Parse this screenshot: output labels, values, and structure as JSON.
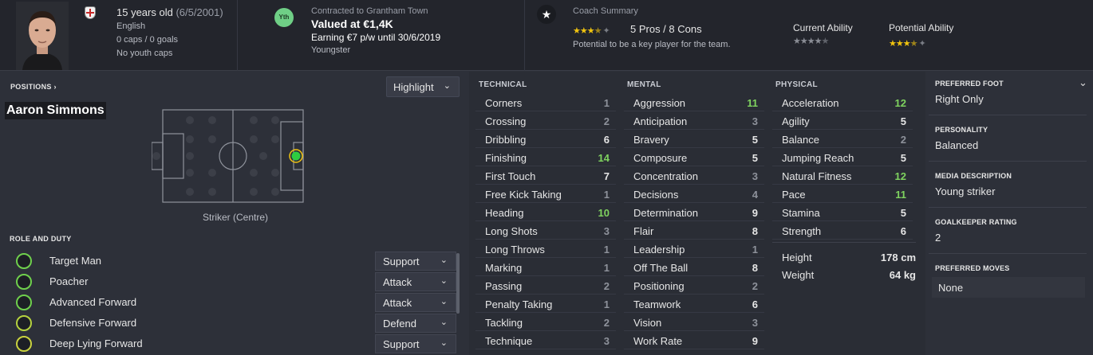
{
  "player": {
    "name": "Aaron Simmons",
    "age_line": "15 years old",
    "dob": "(6/5/2001)",
    "nationality": "English",
    "caps": "0 caps / 0 goals",
    "youth_caps": "No youth caps"
  },
  "contract": {
    "badge": "Yth",
    "club_line": "Contracted to Grantham Town",
    "value": "Valued at €1,4K",
    "earning": "Earning €7 p/w until 30/6/2019",
    "type": "Youngster"
  },
  "coach": {
    "title": "Coach Summary",
    "pros_cons": "5 Pros / 8 Cons",
    "text": "Potential to be a key player for the team.",
    "current_label": "Current Ability",
    "potential_label": "Potential Ability",
    "coach_stars": 3.5,
    "current_stars": 0,
    "potential_stars": 3.5
  },
  "positions": {
    "header": "POSITIONS ›",
    "highlight": "Highlight",
    "position_name": "Striker (Centre)"
  },
  "roles": {
    "header": "ROLE AND DUTY",
    "items": [
      {
        "name": "Target Man",
        "duty": "Support"
      },
      {
        "name": "Poacher",
        "duty": "Attack"
      },
      {
        "name": "Advanced Forward",
        "duty": "Attack"
      },
      {
        "name": "Defensive Forward",
        "duty": "Defend"
      },
      {
        "name": "Deep Lying Forward",
        "duty": "Support"
      }
    ]
  },
  "technical": {
    "header": "TECHNICAL",
    "attrs": [
      {
        "name": "Corners",
        "value": "1"
      },
      {
        "name": "Crossing",
        "value": "2"
      },
      {
        "name": "Dribbling",
        "value": "6"
      },
      {
        "name": "Finishing",
        "value": "14"
      },
      {
        "name": "First Touch",
        "value": "7"
      },
      {
        "name": "Free Kick Taking",
        "value": "1"
      },
      {
        "name": "Heading",
        "value": "10"
      },
      {
        "name": "Long Shots",
        "value": "3"
      },
      {
        "name": "Long Throws",
        "value": "1"
      },
      {
        "name": "Marking",
        "value": "1"
      },
      {
        "name": "Passing",
        "value": "2"
      },
      {
        "name": "Penalty Taking",
        "value": "1"
      },
      {
        "name": "Tackling",
        "value": "2"
      },
      {
        "name": "Technique",
        "value": "3"
      }
    ]
  },
  "mental": {
    "header": "MENTAL",
    "attrs": [
      {
        "name": "Aggression",
        "value": "11"
      },
      {
        "name": "Anticipation",
        "value": "3"
      },
      {
        "name": "Bravery",
        "value": "5"
      },
      {
        "name": "Composure",
        "value": "5"
      },
      {
        "name": "Concentration",
        "value": "3"
      },
      {
        "name": "Decisions",
        "value": "4"
      },
      {
        "name": "Determination",
        "value": "9"
      },
      {
        "name": "Flair",
        "value": "8"
      },
      {
        "name": "Leadership",
        "value": "1"
      },
      {
        "name": "Off The Ball",
        "value": "8"
      },
      {
        "name": "Positioning",
        "value": "2"
      },
      {
        "name": "Teamwork",
        "value": "6"
      },
      {
        "name": "Vision",
        "value": "3"
      },
      {
        "name": "Work Rate",
        "value": "9"
      }
    ]
  },
  "physical": {
    "header": "PHYSICAL",
    "attrs": [
      {
        "name": "Acceleration",
        "value": "12"
      },
      {
        "name": "Agility",
        "value": "5"
      },
      {
        "name": "Balance",
        "value": "2"
      },
      {
        "name": "Jumping Reach",
        "value": "5"
      },
      {
        "name": "Natural Fitness",
        "value": "12"
      },
      {
        "name": "Pace",
        "value": "11"
      },
      {
        "name": "Stamina",
        "value": "5"
      },
      {
        "name": "Strength",
        "value": "6"
      }
    ],
    "height_label": "Height",
    "height": "178 cm",
    "weight_label": "Weight",
    "weight": "64 kg"
  },
  "info": {
    "foot_header": "PREFERRED FOOT",
    "foot": "Right Only",
    "personality_header": "PERSONALITY",
    "personality": "Balanced",
    "media_header": "MEDIA DESCRIPTION",
    "media": "Young striker",
    "gk_header": "GOALKEEPER RATING",
    "gk": "2",
    "moves_header": "PREFERRED MOVES",
    "moves": "None"
  },
  "colors": {
    "high": "#7fd35f",
    "low": "#8e929b",
    "accent_green": "#2ecc40",
    "star": "#f1c40f"
  }
}
